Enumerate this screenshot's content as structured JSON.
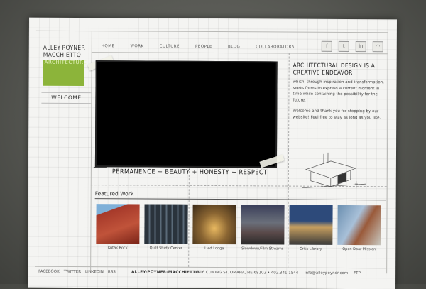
{
  "logo": {
    "line1": "ALLEY-POYNER",
    "line2": "MACCHIETTO",
    "line3": "ARCHITECTURE",
    "color": "#8cb43a"
  },
  "sidebar": {
    "welcome_label": "WELCOME"
  },
  "nav": {
    "items": [
      "HOME",
      "WORK",
      "CULTURE",
      "PEOPLE",
      "BLOG",
      "COLLABORATORS"
    ]
  },
  "social_icons": [
    "facebook-icon",
    "twitter-icon",
    "linkedin-icon",
    "rss-icon"
  ],
  "tagline": "PERMANENCE + BEAUTY + HONESTY + RESPECT",
  "headline": {
    "line1": "ARCHITECTURAL DESIGN IS A",
    "line2": "CREATIVE ENDEAVOR"
  },
  "intro_text": "which, through inspiration and transformation, seeks forms to express a current moment in time while containing the possibility for the future.",
  "welcome_text": "Welcome and thank you for stopping by our website! Feel free to stay as long as you like.",
  "featured": {
    "title": "Featured Work",
    "items": [
      {
        "caption": "Kutak Rock",
        "color": "#a6392a"
      },
      {
        "caption": "Quilt Study Center",
        "color": "#3e4a55"
      },
      {
        "caption": "Lied Lodge",
        "color": "#8a6532"
      },
      {
        "caption": "Slowdown/Film Streams",
        "color": "#5a4a4a"
      },
      {
        "caption": "Criss Library",
        "color": "#2d4a7a"
      },
      {
        "caption": "Open Door Mission",
        "color": "#6b8fb0"
      }
    ]
  },
  "footer": {
    "links": [
      "FACEBOOK",
      "TWITTER",
      "LINKEDIN",
      "RSS"
    ],
    "name": "ALLEY-POYNER-MACCHIETTO",
    "address": "1516 CUMING ST.    OMAHA, NE 68102 • 402.341.1544",
    "email": "info@alleypoyner.com",
    "ftp": "FTP"
  }
}
